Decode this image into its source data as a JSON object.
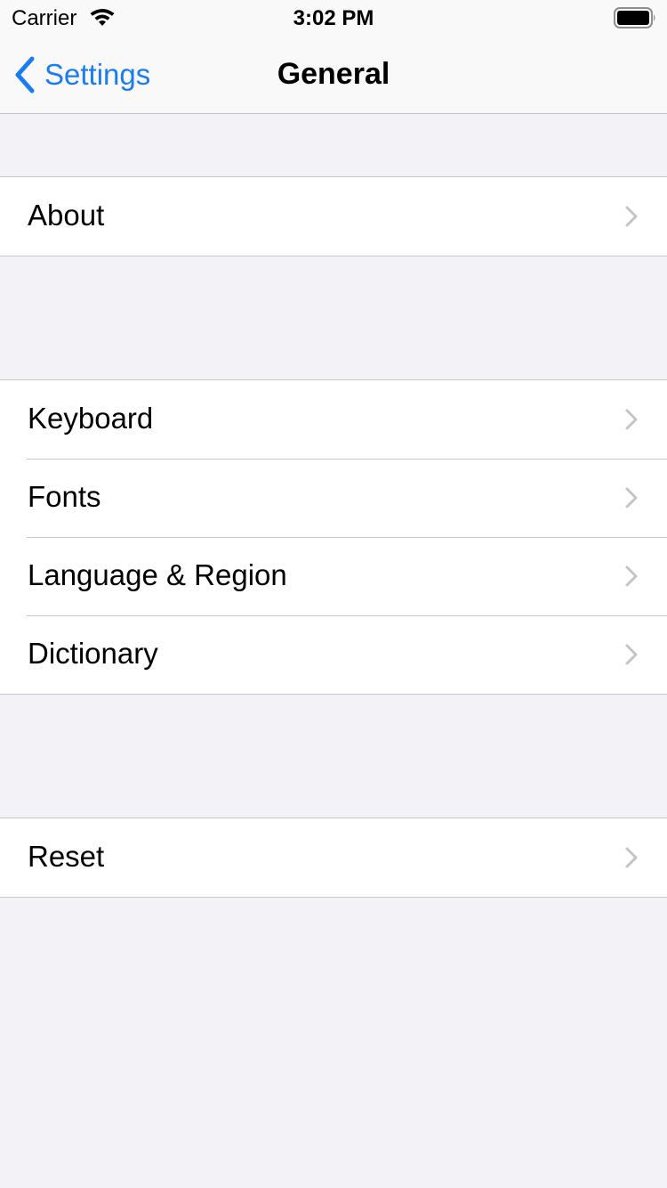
{
  "status_bar": {
    "carrier": "Carrier",
    "time": "3:02 PM",
    "icons": [
      "wifi-icon",
      "battery-icon"
    ]
  },
  "nav": {
    "back_label": "Settings",
    "title": "General",
    "back_icon": "chevron-left-icon",
    "accent_color": "#1a7cf2"
  },
  "groups": [
    {
      "items": [
        {
          "label": "About"
        }
      ]
    },
    {
      "items": [
        {
          "label": "Keyboard"
        },
        {
          "label": "Fonts"
        },
        {
          "label": "Language & Region"
        },
        {
          "label": "Dictionary"
        }
      ]
    },
    {
      "items": [
        {
          "label": "Reset"
        }
      ]
    }
  ],
  "row_accessory_icon": "chevron-right-icon",
  "colors": {
    "background": "#f2f2f7",
    "cell": "#ffffff",
    "separator": "#c8c7cc",
    "chevron": "#c4c4c7"
  }
}
